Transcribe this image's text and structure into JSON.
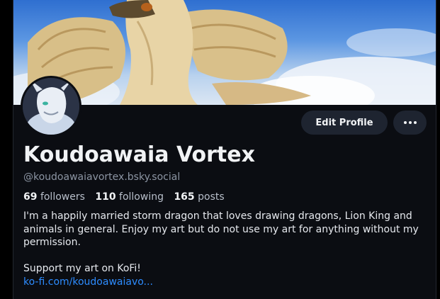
{
  "profile": {
    "display_name": "Koudoawaia Vortex",
    "handle": "@koudoawaiavortex.bsky.social",
    "stats": {
      "followers_count": "69",
      "followers_label": "followers",
      "following_count": "110",
      "following_label": "following",
      "posts_count": "165",
      "posts_label": "posts"
    },
    "bio": {
      "line1": "I'm a happily married storm dragon that loves drawing dragons, Lion King and animals in general. Enjoy my art but do not use my art for anything without my permission.",
      "line2": "Support my art on KoFi!",
      "link": "ko-fi.com/koudoawaiavo..."
    }
  },
  "actions": {
    "edit_profile_label": "Edit Profile",
    "more_icon": "ellipsis-icon"
  },
  "colors": {
    "background": "#0b0d12",
    "button_bg": "#1e2430",
    "link": "#2d8cff",
    "muted_text": "#8c95a3"
  }
}
